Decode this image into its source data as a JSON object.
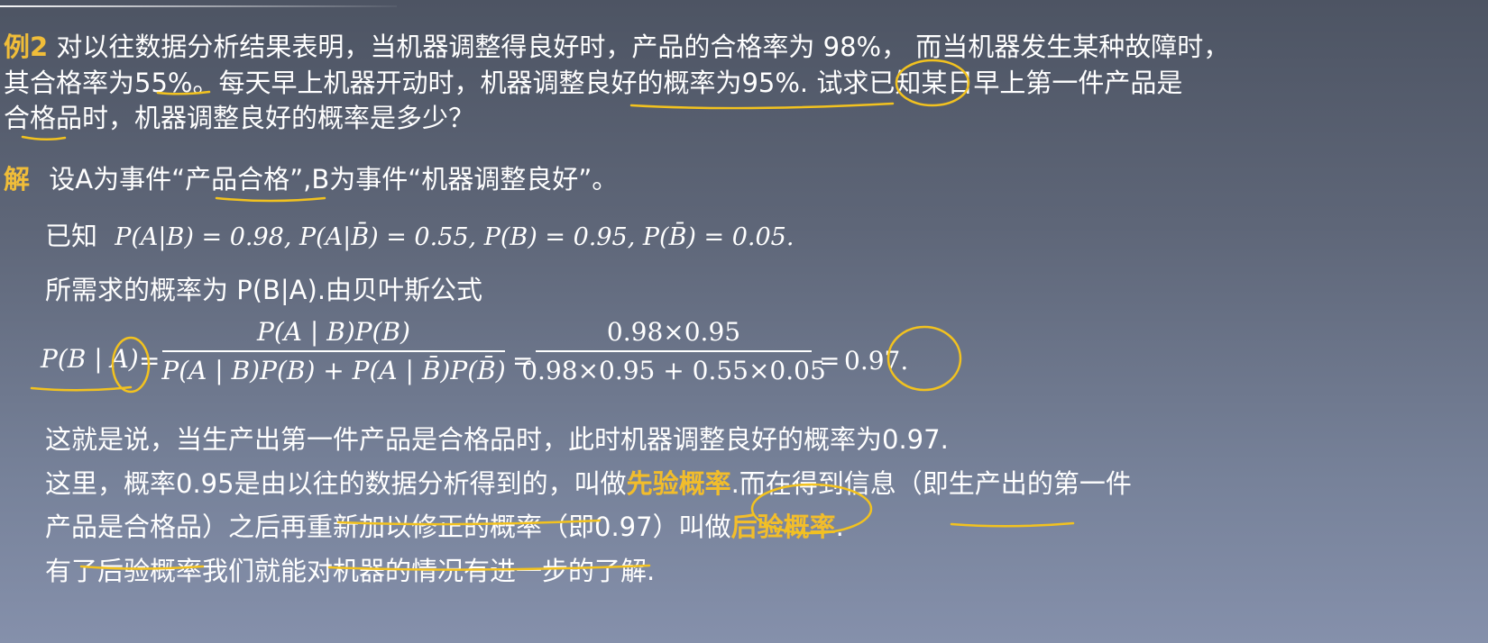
{
  "problem": {
    "label": "例2",
    "line1_text": "对以往数据分析结果表明，当机器调整得良好时，产品的合格率为 98%， 而当机器发生某种故障时，",
    "line2_text": "其合格率为55%。每天早上机器开动时，机器调整良好的概率为95%. 试求已知某日早上第一件产品是",
    "line3_text": "合格品时，机器调整良好的概率是多少？"
  },
  "solution": {
    "label": "解",
    "define_text": "设A为事件“产品合格”,B为事件“机器调整良好”。",
    "known_label": "已知",
    "known_formula": "P(A|B) = 0.98, P(A|B̄) = 0.55, P(B) = 0.95, P(B̄) = 0.05.",
    "target_text": "所需求的概率为 P(B|A).由贝叶斯公式",
    "formula": {
      "lhs": "P(B | A)",
      "eq": "=",
      "frac1_num": "P(A | B)P(B)",
      "frac1_den": "P(A | B)P(B) + P(A | B̄)P(B̄)",
      "frac2_num": "0.98×0.95",
      "frac2_den": "0.98×0.95 + 0.55×0.05",
      "result": "0.97."
    }
  },
  "conclusion": {
    "line1": "这就是说，当生产出第一件产品是合格品时，此时机器调整良好的概率为0.97.",
    "line2_a": "这里，概率0.95是由以往的数据分析得到的，叫做",
    "line2_term": "先验概率",
    "line2_b": ".而在得到信息（即生产出的第一件",
    "line3_a": "产品是合格品）之后再重新加以修正的概率（即0.97）叫做",
    "line3_term": "后验概率",
    "line3_b": ".",
    "line4": "有了后验概率我们就能对机器的情况有进一步的了解."
  },
  "colors": {
    "highlight": "#f2bd2b",
    "annotation_ink": "#f2c21f",
    "text": "#ffffff"
  }
}
